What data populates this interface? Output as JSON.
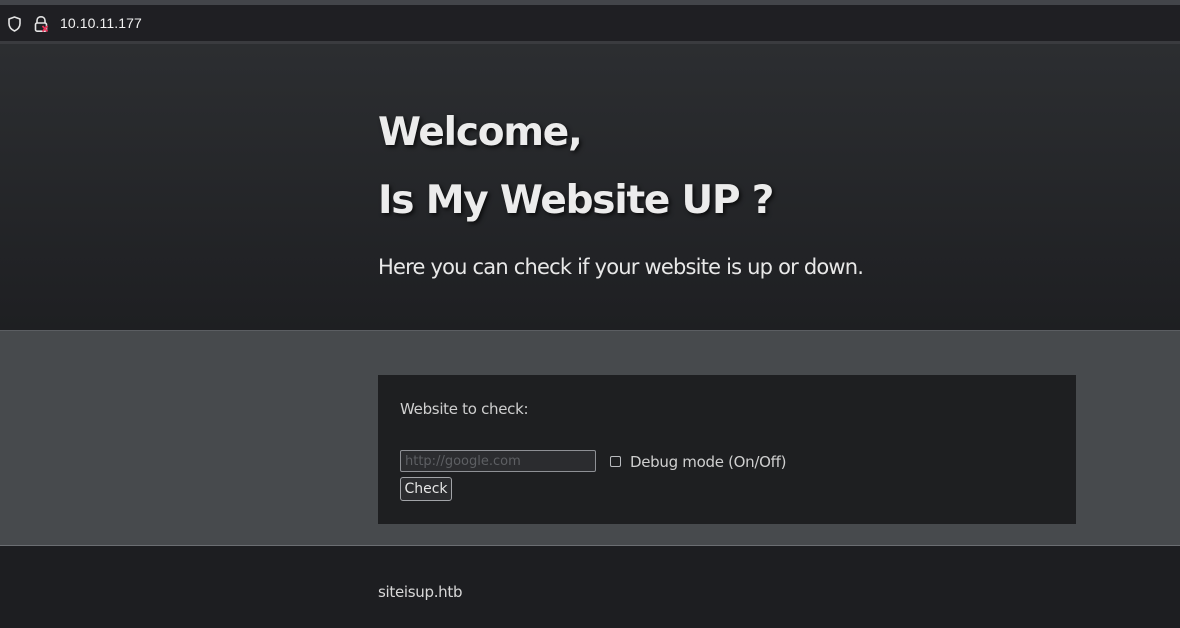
{
  "browser": {
    "url": "10.10.11.177",
    "icons": [
      "shield-icon",
      "lock-icon"
    ]
  },
  "hero": {
    "welcome": "Welcome,",
    "title": "Is My Website UP ?",
    "subtitle": "Here you can check if your website is up or down."
  },
  "form": {
    "label": "Website to check:",
    "input_placeholder": "http://google.com",
    "input_value": "",
    "debug_label": "Debug mode (On/Off)",
    "debug_checked": false,
    "submit_label": "Check"
  },
  "footer": {
    "text": "siteisup.htb"
  },
  "colors": {
    "page_bg": "#1d1e21",
    "mid_bg": "#474a4d",
    "card_bg": "#1e1f21",
    "heading_text": "#ececec",
    "lock_accent": "#e8335a"
  }
}
